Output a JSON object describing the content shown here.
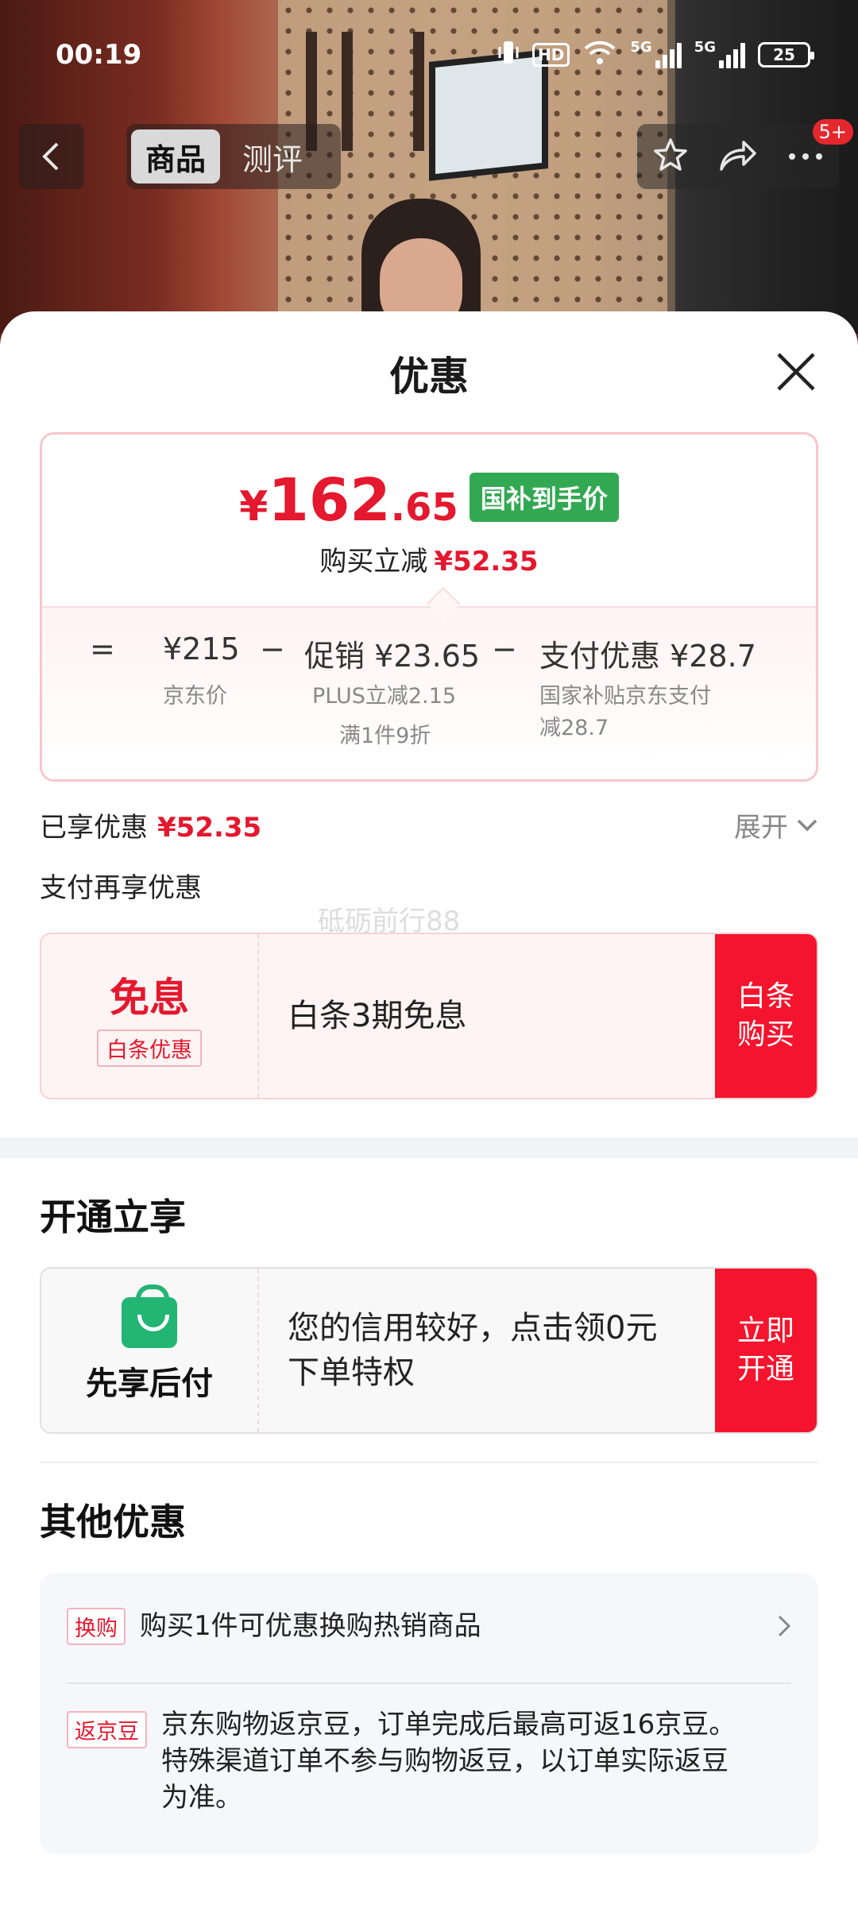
{
  "status_bar": {
    "time": "00:19",
    "network1": "5G",
    "network2": "5G",
    "hd": "HD",
    "battery": "25"
  },
  "nav": {
    "tabs": [
      {
        "label": "商品",
        "active": true
      },
      {
        "label": "测评",
        "active": false
      }
    ],
    "badge": "5+"
  },
  "sheet": {
    "title": "优惠",
    "price": {
      "currency": "¥",
      "integer": "162",
      "decimal": ".65",
      "tag": "国补到手价",
      "reduce_label": "购买立减",
      "reduce_value": "¥52.35"
    },
    "breakdown": {
      "eq": "=",
      "minus": "−",
      "jd_price": "¥215",
      "jd_price_label": "京东价",
      "promo": "促销 ¥23.65",
      "promo_sub1": "PLUS立减2.15",
      "promo_sub2": "满1件9折",
      "pay": "支付优惠 ¥28.7",
      "pay_sub1": "国家补贴京东支付",
      "pay_sub2": "减28.7"
    },
    "saved_label": "已享优惠",
    "saved_value": "¥52.35",
    "expand_label": "展开",
    "pay_more_label": "支付再享优惠",
    "watermark": "砥砺前行88",
    "baitiao": {
      "title": "免息",
      "tag": "白条优惠",
      "text": "白条3期免息",
      "button": "白条购买"
    },
    "open_section_title": "开通立享",
    "credit": {
      "title": "先享后付",
      "text": "您的信用较好，点击领0元下单特权",
      "button": "立即开通"
    },
    "other_section_title": "其他优惠",
    "other": [
      {
        "tag": "换购",
        "text": "购买1件可优惠换购热销商品"
      },
      {
        "tag": "返京豆",
        "text": "京东购物返京豆，订单完成后最高可返16京豆。特殊渠道订单不参与购物返豆，以订单实际返豆为准。"
      }
    ]
  },
  "colors": {
    "accent_red": "#e4182e",
    "button_red": "#f5142d",
    "green_tag": "#33a853",
    "green_bag": "#22b573"
  }
}
